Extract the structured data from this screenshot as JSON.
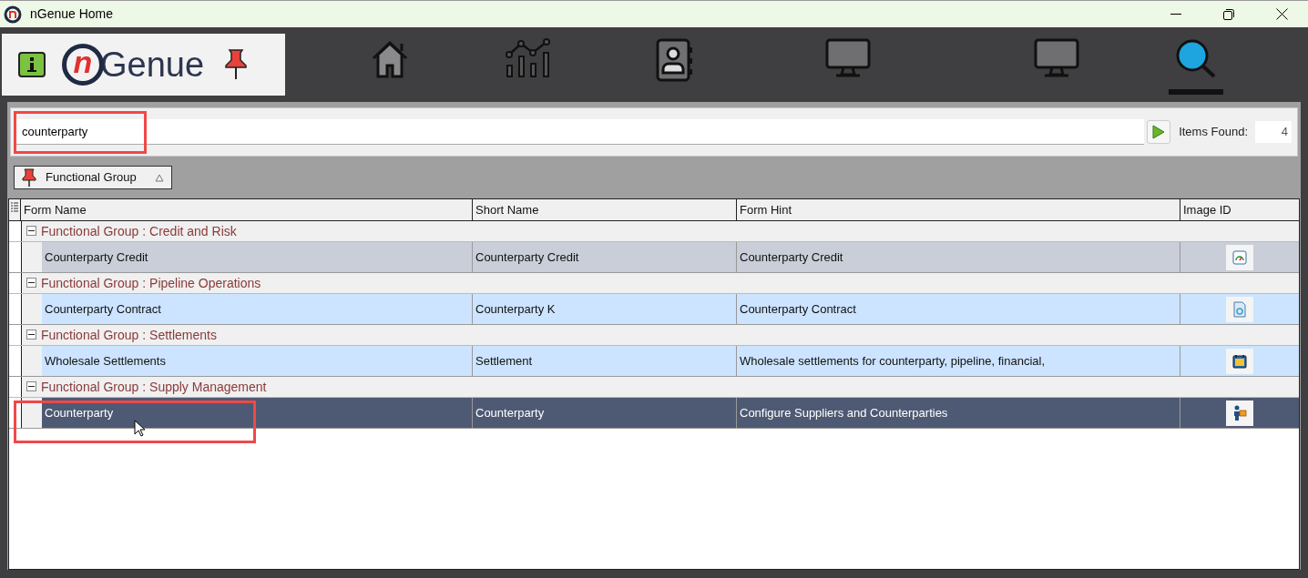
{
  "window": {
    "title": "nGenue Home"
  },
  "nav": [
    {
      "kind": "home",
      "selected": false
    },
    {
      "kind": "chart",
      "selected": false
    },
    {
      "kind": "contacts",
      "selected": false
    },
    {
      "kind": "monitor",
      "selected": false
    },
    {
      "kind": "monitor",
      "selected": false
    },
    {
      "kind": "search",
      "selected": true
    }
  ],
  "logo": {
    "text_accent": "n",
    "text": "Genue"
  },
  "search": {
    "value": "counterparty",
    "items_found_label": "Items Found:",
    "items_found": "4"
  },
  "group_by": {
    "label": "Functional Group"
  },
  "table": {
    "columns": [
      "Form Name",
      "Short Name",
      "Form Hint",
      "Image ID"
    ],
    "groups": [
      {
        "label": "Functional Group : Credit and Risk",
        "expanded": true,
        "rows": [
          {
            "cells": [
              "Counterparty Credit",
              "Counterparty Credit",
              "Counterparty Credit"
            ],
            "selected": false,
            "focused": true
          }
        ]
      },
      {
        "label": "Functional Group : Pipeline Operations",
        "expanded": true,
        "rows": [
          {
            "cells": [
              "Counterparty Contract",
              "Counterparty K",
              "Counterparty Contract"
            ],
            "selected": false,
            "focused": false
          }
        ]
      },
      {
        "label": "Functional Group : Settlements",
        "expanded": true,
        "rows": [
          {
            "cells": [
              "Wholesale Settlements",
              "Settlement",
              "Wholesale settlements for counterparty, pipeline, financial,"
            ],
            "selected": false,
            "focused": false
          }
        ]
      },
      {
        "label": "Functional Group : Supply Management",
        "expanded": true,
        "rows": [
          {
            "cells": [
              "Counterparty",
              "Counterparty",
              "Configure Suppliers and Counterparties"
            ],
            "selected": true,
            "focused": false
          }
        ]
      }
    ]
  }
}
